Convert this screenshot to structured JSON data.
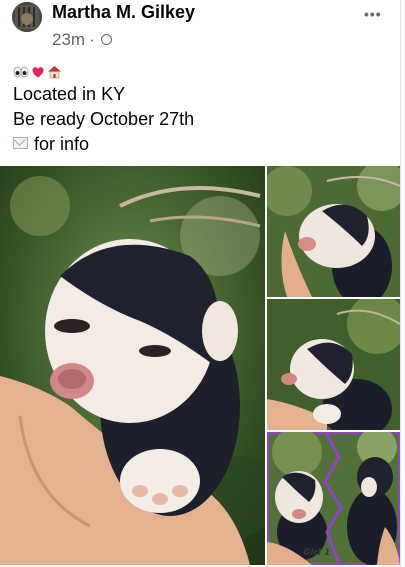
{
  "post": {
    "author": "Martha M. Gilkey",
    "time": "23m",
    "separator": "·",
    "audience_icon": "globe-icon",
    "more_icon": "more-options-icon",
    "more_label": "•••",
    "emoji_line": [
      "eyes-emoji",
      "red-heart-emoji",
      "house-emoji"
    ],
    "lines": [
      "Located in KY",
      "Be ready October 27th",
      "for info"
    ],
    "mail_icon": "envelope-emoji"
  },
  "photos": {
    "thumbnail_3_caption": "Girl 1"
  },
  "colors": {
    "name": "#050505",
    "meta": "#65676b",
    "frame": "#8e44c4"
  }
}
